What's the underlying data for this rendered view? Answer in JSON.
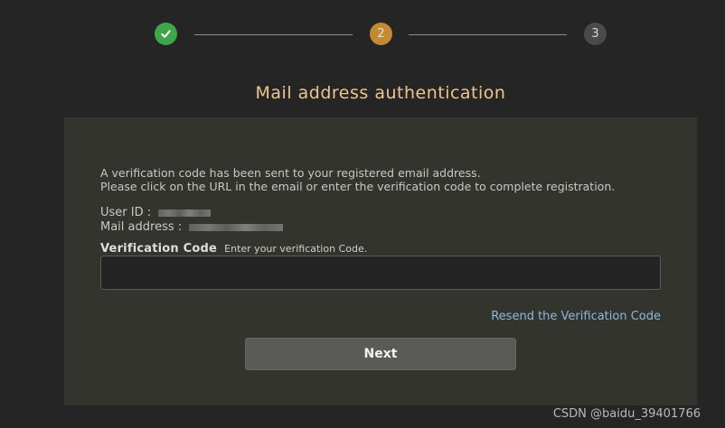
{
  "stepper": {
    "steps": [
      {
        "label": "",
        "state": "completed",
        "color": "#3fa64b",
        "icon": "check-icon"
      },
      {
        "label": "2",
        "state": "current",
        "color": "#c28a33"
      },
      {
        "label": "3",
        "state": "upcoming",
        "color": "#4a4a4a"
      }
    ]
  },
  "title": "Mail address authentication",
  "message": {
    "line1": "A verification code has been sent to your registered email address.",
    "line2": "Please click on the URL in the email or enter the verification code to complete registration."
  },
  "meta": {
    "user_id_label": "User ID :",
    "mail_address_label": "Mail address :"
  },
  "verification": {
    "label": "Verification Code",
    "hint": "Enter your verification Code.",
    "value": "",
    "placeholder": ""
  },
  "actions": {
    "resend": "Resend the Verification Code",
    "next": "Next"
  },
  "watermark": "CSDN @baidu_39401766",
  "colors": {
    "background": "#252525",
    "card": "#34342f",
    "title": "#f0c58d",
    "link": "#8fb8d7"
  }
}
